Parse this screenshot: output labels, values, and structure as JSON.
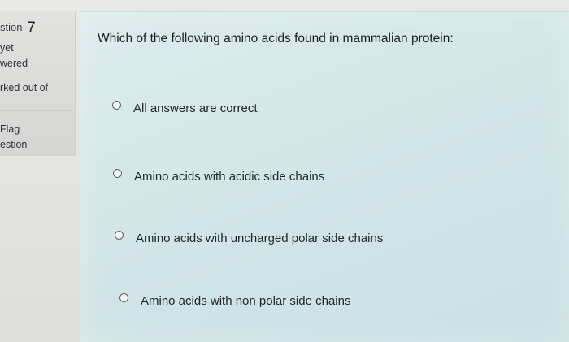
{
  "info": {
    "question_prefix": "stion",
    "question_number": "7",
    "status_line1": "yet",
    "status_line2": "wered",
    "marks_label": "rked out of",
    "flag_line1": "Flag",
    "flag_line2": "estion"
  },
  "question": {
    "text": "Which of the following amino acids found in mammalian protein:",
    "options": [
      "All answers are correct",
      "Amino acids with acidic side chains",
      "Amino acids with uncharged polar side chains",
      "Amino acids with non polar side chains"
    ]
  }
}
